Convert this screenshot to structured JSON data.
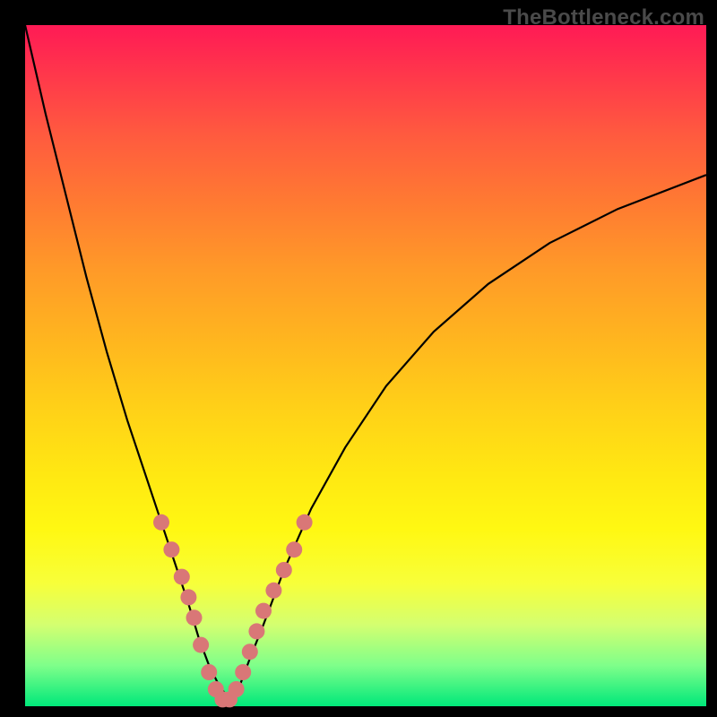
{
  "watermark": "TheBottleneck.com",
  "chart_data": {
    "type": "line",
    "title": "",
    "xlabel": "",
    "ylabel": "",
    "xlim": [
      0,
      100
    ],
    "ylim": [
      0,
      100
    ],
    "grid": false,
    "background_gradient": [
      "#ff1a55",
      "#ffd018",
      "#00e87a"
    ],
    "series": [
      {
        "name": "bottleneck-curve",
        "x": [
          0,
          3,
          6,
          9,
          12,
          15,
          18,
          20,
          22,
          24,
          25.5,
          27,
          28.5,
          30,
          31.5,
          33,
          35,
          38,
          42,
          47,
          53,
          60,
          68,
          77,
          87,
          100
        ],
        "y": [
          100,
          87,
          75,
          63,
          52,
          42,
          33,
          27,
          21,
          15,
          10,
          6,
          3,
          1,
          3,
          7,
          12,
          20,
          29,
          38,
          47,
          55,
          62,
          68,
          73,
          78
        ]
      }
    ],
    "markers": {
      "name": "highlighted-points",
      "x": [
        20,
        21.5,
        23,
        24,
        24.8,
        25.8,
        27,
        28,
        29,
        30,
        31,
        32,
        33,
        34,
        35,
        36.5,
        38,
        39.5,
        41
      ],
      "y": [
        27,
        23,
        19,
        16,
        13,
        9,
        5,
        2.5,
        1,
        1,
        2.5,
        5,
        8,
        11,
        14,
        17,
        20,
        23,
        27
      ]
    }
  }
}
